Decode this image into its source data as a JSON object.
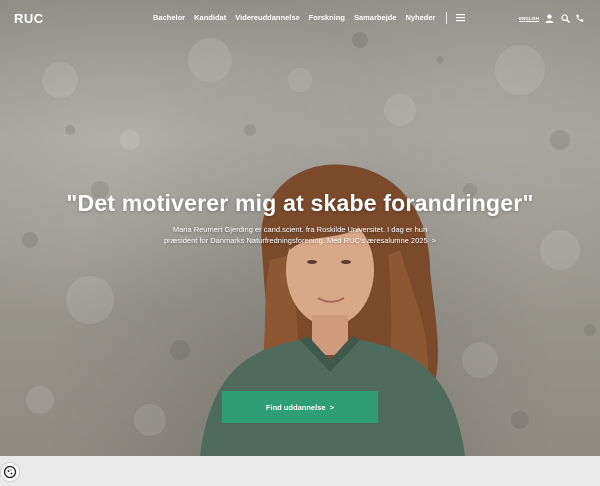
{
  "header": {
    "logo_text": "RUC",
    "nav": [
      "Bachelor",
      "Kandidat",
      "Videreuddannelse",
      "Forskning",
      "Samarbejde",
      "Nyheder"
    ],
    "language_link": "ENGLISH",
    "icons": [
      "menu-icon",
      "user-icon",
      "search-icon",
      "phone-icon"
    ]
  },
  "hero": {
    "headline": "\"Det motiverer mig at skabe forandringer\"",
    "subtext_line1": "Maria Reumert Gjerding er cand.scient. fra Roskilde Universitet. I dag er hun",
    "subtext_line2": "præsident for Danmarks Naturfredningsforening. Med RUC's æresalumne 2025",
    "subtext_arrow": ">",
    "cta_label": "Find uddannelse  >"
  },
  "colors": {
    "cta_green": "#2e9e76",
    "text_white": "#ffffff"
  },
  "cookie_icon": "cookie-settings-icon"
}
